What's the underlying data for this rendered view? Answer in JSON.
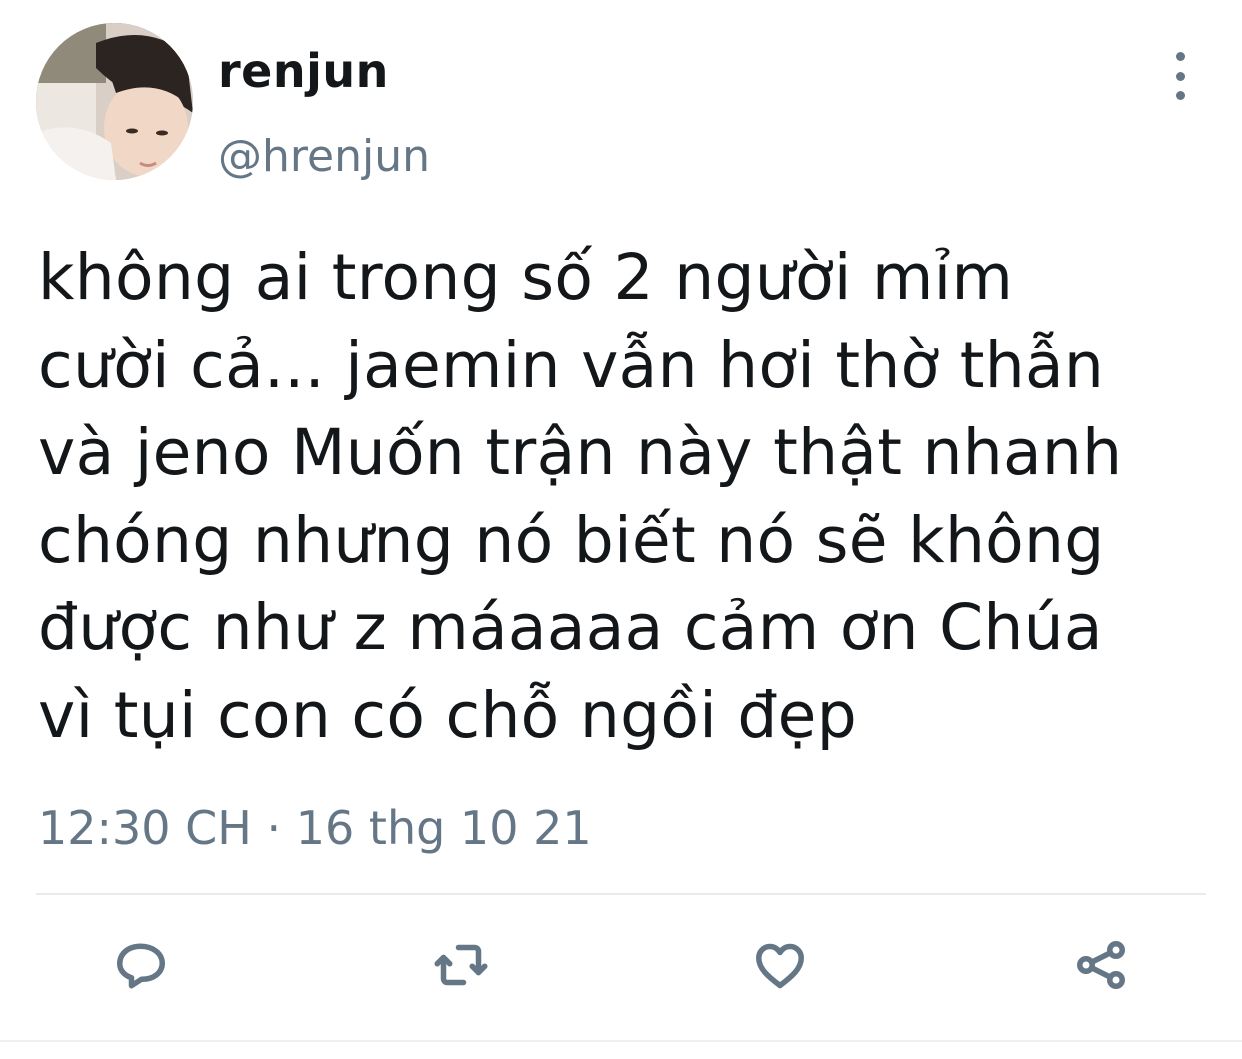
{
  "tweet": {
    "display_name": "renjun",
    "handle": "@hrenjun",
    "text": "không ai trong số 2 người mỉm\ncười cả... jaemin vẫn hơi thờ thẫn\nvà jeno Muốn trận này thật nhanh\nchóng nhưng nó biết nó sẽ không\nđược như z máaaaa cảm ơn Chúa\nvì tụi con có chỗ ngồi đẹp",
    "timestamp": "12:30 CH · 16 thg 10 21"
  },
  "icons": {
    "more": "more-vertical-icon",
    "reply": "reply-icon",
    "retweet": "retweet-icon",
    "like": "heart-icon",
    "share": "share-icon"
  },
  "colors": {
    "text": "#14171a",
    "secondary": "#657786",
    "divider": "#e6ecf0"
  }
}
